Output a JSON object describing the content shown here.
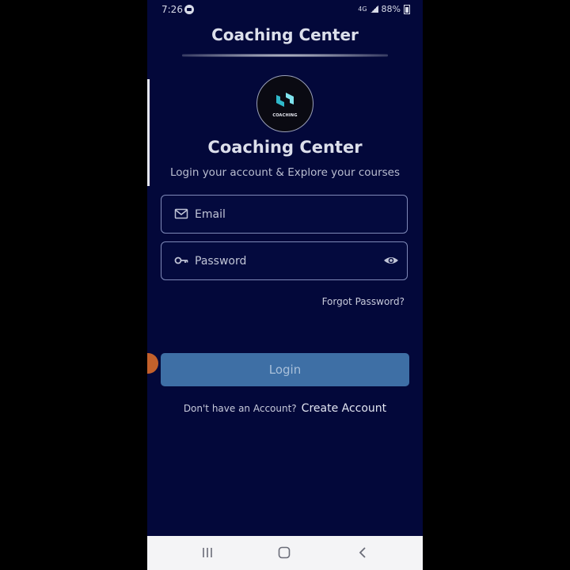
{
  "status_bar": {
    "time": "7:26",
    "network": "4G",
    "battery": "88%"
  },
  "header": {
    "title": "Coaching Center"
  },
  "logo": {
    "text": "COACHING"
  },
  "app": {
    "title": "Coaching Center",
    "subtitle": "Login your account & Explore your courses"
  },
  "form": {
    "email_placeholder": "Email",
    "password_placeholder": "Password",
    "forgot_label": "Forgot Password?",
    "login_label": "Login"
  },
  "signup": {
    "prompt": "Don't have an Account?",
    "link": "Create Account"
  },
  "colors": {
    "background": "#03083a",
    "button": "#3e6fa5",
    "accent": "#2fb8c9"
  },
  "icons": [
    "mail-icon",
    "key-icon",
    "eye-icon",
    "recent-apps-icon",
    "home-icon",
    "back-icon"
  ]
}
